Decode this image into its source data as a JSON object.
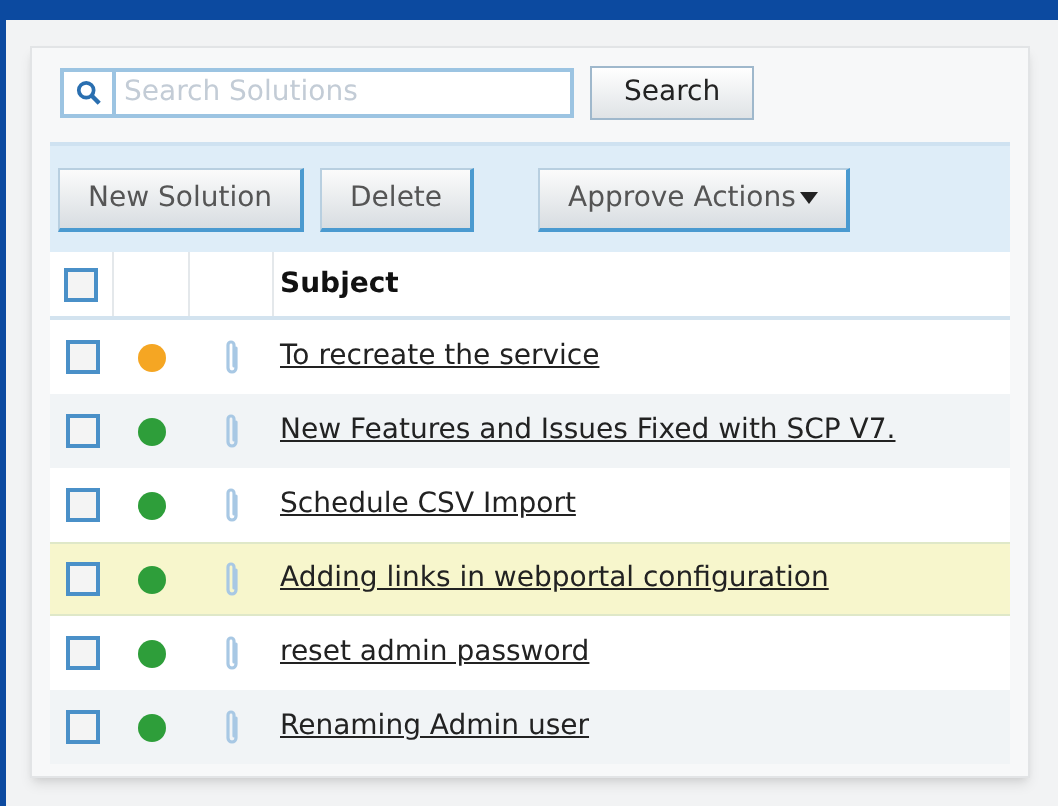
{
  "search": {
    "placeholder": "Search Solutions",
    "button": "Search"
  },
  "toolbar": {
    "buttons": [
      {
        "label": "New Solution",
        "kind": "plain"
      },
      {
        "label": "Delete",
        "kind": "plain"
      },
      {
        "label": "Approve Actions",
        "kind": "dropdown"
      }
    ]
  },
  "table": {
    "select_all": {
      "checked": false
    },
    "columns": [
      "Subject"
    ],
    "rows": [
      {
        "checked": false,
        "color": "#f5a623",
        "subject": "To recreate the service",
        "highlighted": false
      },
      {
        "checked": false,
        "color": "#2e9e3a",
        "subject": "New Features and Issues Fixed with SCP V7.",
        "highlighted": false
      },
      {
        "checked": false,
        "color": "#2e9e3a",
        "subject": "Schedule CSV Import",
        "highlighted": false
      },
      {
        "checked": false,
        "color": "#2e9e3a",
        "subject": "Adding links in webportal configuration",
        "highlighted": true
      },
      {
        "checked": false,
        "color": "#2e9e3a",
        "subject": "reset admin password",
        "highlighted": false
      },
      {
        "checked": false,
        "color": "#2e9e3a",
        "subject": "Renaming Admin user",
        "highlighted": false
      }
    ]
  }
}
